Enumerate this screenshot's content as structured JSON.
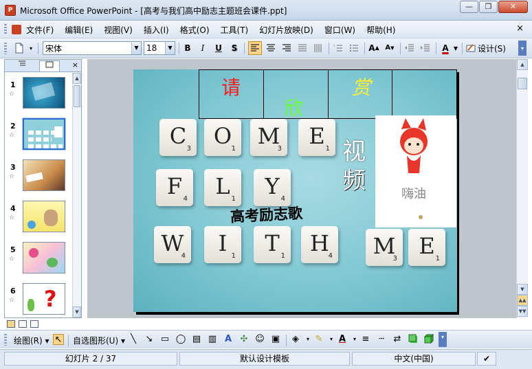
{
  "window": {
    "title": "Microsoft Office PowerPoint - [高考与我们高中励志主题班会课件.ppt]",
    "minimize": "—",
    "restore": "❐",
    "close": "✕"
  },
  "menu": {
    "items": [
      "文件(F)",
      "编辑(E)",
      "视图(V)",
      "插入(I)",
      "格式(O)",
      "工具(T)",
      "幻灯片放映(D)",
      "窗口(W)",
      "帮助(H)"
    ],
    "close_doc": "×"
  },
  "toolbar": {
    "font_name": "宋体",
    "font_size": "18",
    "bold": "B",
    "italic": "I",
    "underline": "U",
    "shadow": "S",
    "design": "设计(S)"
  },
  "left_pane": {
    "close": "×",
    "slides": [
      {
        "num": "1",
        "star": "☆"
      },
      {
        "num": "2",
        "star": "☆"
      },
      {
        "num": "3",
        "star": "☆"
      },
      {
        "num": "4",
        "star": "☆"
      },
      {
        "num": "5",
        "star": "☆"
      },
      {
        "num": "6",
        "star": "☆"
      }
    ]
  },
  "slide": {
    "cells": [
      "请",
      "欣",
      "赏"
    ],
    "side_words": [
      "视",
      "频"
    ],
    "song_title": "高考励志歌",
    "tiles": [
      {
        "ch": "C",
        "score": "3"
      },
      {
        "ch": "O",
        "score": "1"
      },
      {
        "ch": "M",
        "score": "3"
      },
      {
        "ch": "E",
        "score": "1"
      },
      {
        "ch": "F",
        "score": "4"
      },
      {
        "ch": "L",
        "score": "1"
      },
      {
        "ch": "Y",
        "score": "4"
      },
      {
        "ch": "W",
        "score": "4"
      },
      {
        "ch": "I",
        "score": "1"
      },
      {
        "ch": "T",
        "score": "1"
      },
      {
        "ch": "H",
        "score": "4"
      },
      {
        "ch": "M",
        "score": "3"
      },
      {
        "ch": "E",
        "score": "1"
      }
    ],
    "picture_text": "嗨油"
  },
  "drawbar": {
    "draw": "绘图(R)",
    "autoshapes": "自选图形(U)"
  },
  "status": {
    "slide_pos": "幻灯片 2 / 37",
    "template": "默认设计模板",
    "language": "中文(中国)"
  },
  "colors": {
    "cell_1": "#ff1a1a",
    "cell_2": "#66ff33",
    "cell_3": "#ffee33"
  }
}
